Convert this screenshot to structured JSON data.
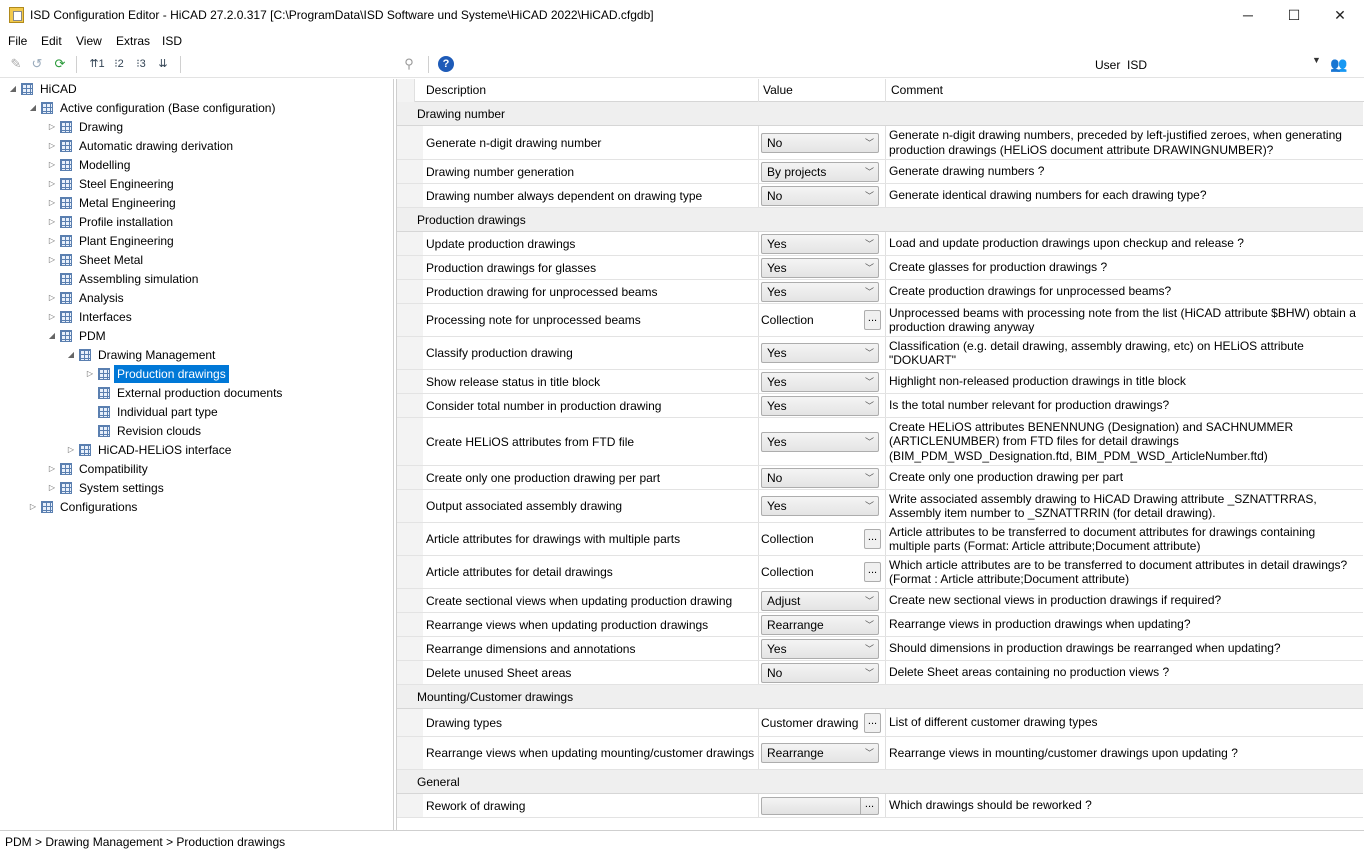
{
  "window": {
    "title": "ISD Configuration Editor  - HiCAD 27.2.0.317 [C:\\ProgramData\\ISD Software und Systeme\\HiCAD 2022\\HiCAD.cfgdb]",
    "minimize": "─",
    "maximize": "☐",
    "close": "✕"
  },
  "menu": [
    "File",
    "Edit",
    "View",
    "Extras",
    "ISD"
  ],
  "toolbar": {
    "user_label": "User",
    "user_value": "ISD"
  },
  "tree": [
    {
      "label": "HiCAD",
      "level": 0,
      "expanded": true,
      "selected": false
    },
    {
      "label": "Active configuration (Base configuration)",
      "level": 1,
      "expanded": true,
      "selected": false
    },
    {
      "label": "Drawing",
      "level": 2,
      "expanded": false,
      "selected": false
    },
    {
      "label": "Automatic drawing derivation",
      "level": 2,
      "expanded": false,
      "selected": false
    },
    {
      "label": "Modelling",
      "level": 2,
      "expanded": false,
      "selected": false
    },
    {
      "label": "Steel Engineering",
      "level": 2,
      "expanded": false,
      "selected": false
    },
    {
      "label": "Metal Engineering",
      "level": 2,
      "expanded": false,
      "selected": false
    },
    {
      "label": "Profile installation",
      "level": 2,
      "expanded": false,
      "selected": false
    },
    {
      "label": "Plant Engineering",
      "level": 2,
      "expanded": false,
      "selected": false
    },
    {
      "label": "Sheet Metal",
      "level": 2,
      "expanded": false,
      "selected": false
    },
    {
      "label": "Assembling simulation",
      "level": 2,
      "expanded": null,
      "selected": false
    },
    {
      "label": "Analysis",
      "level": 2,
      "expanded": false,
      "selected": false
    },
    {
      "label": "Interfaces",
      "level": 2,
      "expanded": false,
      "selected": false
    },
    {
      "label": "PDM",
      "level": 2,
      "expanded": true,
      "selected": false
    },
    {
      "label": "Drawing Management",
      "level": 3,
      "expanded": true,
      "selected": false
    },
    {
      "label": "Production drawings",
      "level": 4,
      "expanded": false,
      "selected": true
    },
    {
      "label": "External production documents",
      "level": 4,
      "expanded": null,
      "selected": false
    },
    {
      "label": "Individual part type",
      "level": 4,
      "expanded": null,
      "selected": false
    },
    {
      "label": "Revision clouds",
      "level": 4,
      "expanded": null,
      "selected": false
    },
    {
      "label": "HiCAD-HELiOS interface",
      "level": 3,
      "expanded": false,
      "selected": false
    },
    {
      "label": "Compatibility",
      "level": 2,
      "expanded": false,
      "selected": false
    },
    {
      "label": "System settings",
      "level": 2,
      "expanded": false,
      "selected": false
    },
    {
      "label": "Configurations",
      "level": 1,
      "expanded": false,
      "selected": false
    }
  ],
  "grid": {
    "headers": {
      "description": "Description",
      "value": "Value",
      "comment": "Comment"
    },
    "categories": [
      {
        "name": "Drawing number",
        "rows": [
          {
            "desc": "Generate n-digit drawing number",
            "type": "combo",
            "value": "No",
            "comment": "Generate n-digit drawing numbers, preceded by left-justified zeroes, when generating production drawings (HELiOS document attribute DRAWINGNUMBER)?",
            "h": 34
          },
          {
            "desc": "Drawing number generation",
            "type": "combo",
            "value": "By projects",
            "comment": "Generate drawing numbers ?",
            "h": 24
          },
          {
            "desc": "Drawing number always dependent on drawing type",
            "type": "combo",
            "value": "No",
            "comment": "Generate identical drawing numbers for each drawing type?",
            "h": 24
          }
        ]
      },
      {
        "name": "Production drawings",
        "rows": [
          {
            "desc": "Update production drawings",
            "type": "combo",
            "value": "Yes",
            "comment": "Load and update production drawings upon checkup and release ?",
            "h": 24
          },
          {
            "desc": "Production drawings for glasses",
            "type": "combo",
            "value": "Yes",
            "comment": "Create glasses for production drawings ?",
            "h": 24
          },
          {
            "desc": "Production drawing for unprocessed beams",
            "type": "combo",
            "value": "Yes",
            "comment": "Create production drawings for unprocessed beams?",
            "h": 24
          },
          {
            "desc": "Processing note for unprocessed beams",
            "type": "collection",
            "value": "Collection",
            "comment": "Unprocessed beams with processing note from the list (HiCAD attribute $BHW) obtain a production drawing anyway",
            "h": 33
          },
          {
            "desc": "Classify production drawing",
            "type": "combo",
            "value": "Yes",
            "comment": "Classification (e.g. detail drawing, assembly drawing, etc) on HELiOS attribute \"DOKUART\"",
            "h": 33
          },
          {
            "desc": "Show release status in title block",
            "type": "combo",
            "value": "Yes",
            "comment": "Highlight non-released production drawings in title block",
            "h": 24
          },
          {
            "desc": "Consider total number in production drawing",
            "type": "combo",
            "value": "Yes",
            "comment": "Is the total number relevant for production drawings?",
            "h": 24
          },
          {
            "desc": "Create HELiOS attributes from FTD file",
            "type": "combo",
            "value": "Yes",
            "comment": "Create HELiOS attributes BENENNUNG (Designation) and SACHNUMMER (ARTICLENUMBER) from  FTD files for detail drawings (BIM_PDM_WSD_Designation.ftd, BIM_PDM_WSD_ArticleNumber.ftd)",
            "h": 48
          },
          {
            "desc": "Create only one production drawing per part",
            "type": "combo",
            "value": "No",
            "comment": "Create only one production drawing per part",
            "h": 24
          },
          {
            "desc": "Output associated assembly drawing",
            "type": "combo",
            "value": "Yes",
            "comment": "Write associated assembly drawing to HiCAD Drawing attribute _SZNATTRRAS, Assembly item number to _SZNATTRRIN (for detail drawing).",
            "h": 33
          },
          {
            "desc": "Article attributes for drawings with multiple parts",
            "type": "collection",
            "value": "Collection",
            "comment": "Article attributes to be transferred to document attributes for drawings containing multiple parts  (Format: Article attribute;Document attribute)",
            "h": 33
          },
          {
            "desc": "Article attributes for detail drawings",
            "type": "collection",
            "value": "Collection",
            "comment": "Which article attributes are to be transferred to document attributes in detail drawings?(Format : Article attribute;Document attribute)",
            "h": 33
          },
          {
            "desc": "Create sectional views when updating production drawing",
            "type": "combo",
            "value": "Adjust",
            "comment": "Create new sectional views in production drawings if required?",
            "h": 24
          },
          {
            "desc": "Rearrange views when updating production drawings",
            "type": "combo",
            "value": "Rearrange",
            "comment": "Rearrange views in production drawings when updating?",
            "h": 24
          },
          {
            "desc": "Rearrange dimensions and annotations",
            "type": "combo",
            "value": "Yes",
            "comment": "Should dimensions in production drawings be rearranged when updating?",
            "h": 24
          },
          {
            "desc": "Delete unused Sheet areas",
            "type": "combo",
            "value": "No",
            "comment": "Delete Sheet areas containing no production views ?",
            "h": 24
          }
        ]
      },
      {
        "name": "Mounting/Customer drawings",
        "rows": [
          {
            "desc": "Drawing types",
            "type": "collection",
            "value": "Customer drawing",
            "comment": "List of different customer drawing types",
            "h": 28
          },
          {
            "desc": "Rearrange views when updating mounting/customer drawings",
            "type": "combo",
            "value": "Rearrange",
            "comment": "Rearrange views in mounting/customer drawings upon updating ?",
            "h": 33
          }
        ]
      },
      {
        "name": "General",
        "rows": [
          {
            "desc": "Rework of drawing",
            "type": "blank",
            "value": "",
            "comment": "Which drawings should be reworked  ?",
            "h": 24
          }
        ]
      }
    ]
  },
  "status": {
    "breadcrumb": "PDM > Drawing Management > Production drawings"
  }
}
